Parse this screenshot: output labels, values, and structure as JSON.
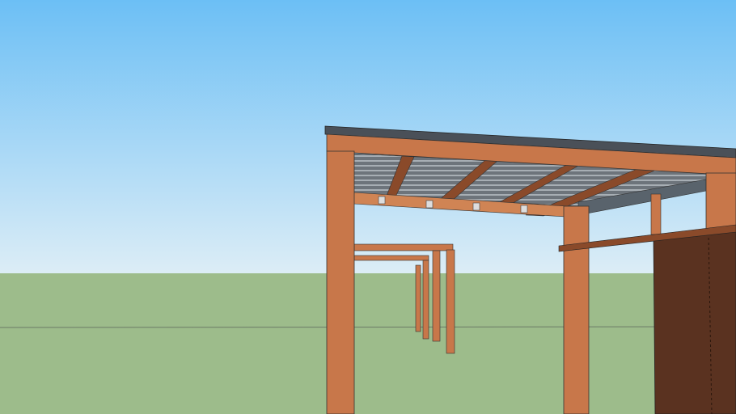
{
  "scene": {
    "colors": {
      "sky_top": "#6cbff5",
      "sky_bottom": "#dcedf6",
      "ground": "#9dbc8b",
      "wood": "#c8774a",
      "wood_dark": "#8a4a2a",
      "wood_shadow": "#6b3a22",
      "roof": "#4a5058",
      "roof_ribs": "#9aa2a8",
      "panel": "#5a3220"
    }
  }
}
